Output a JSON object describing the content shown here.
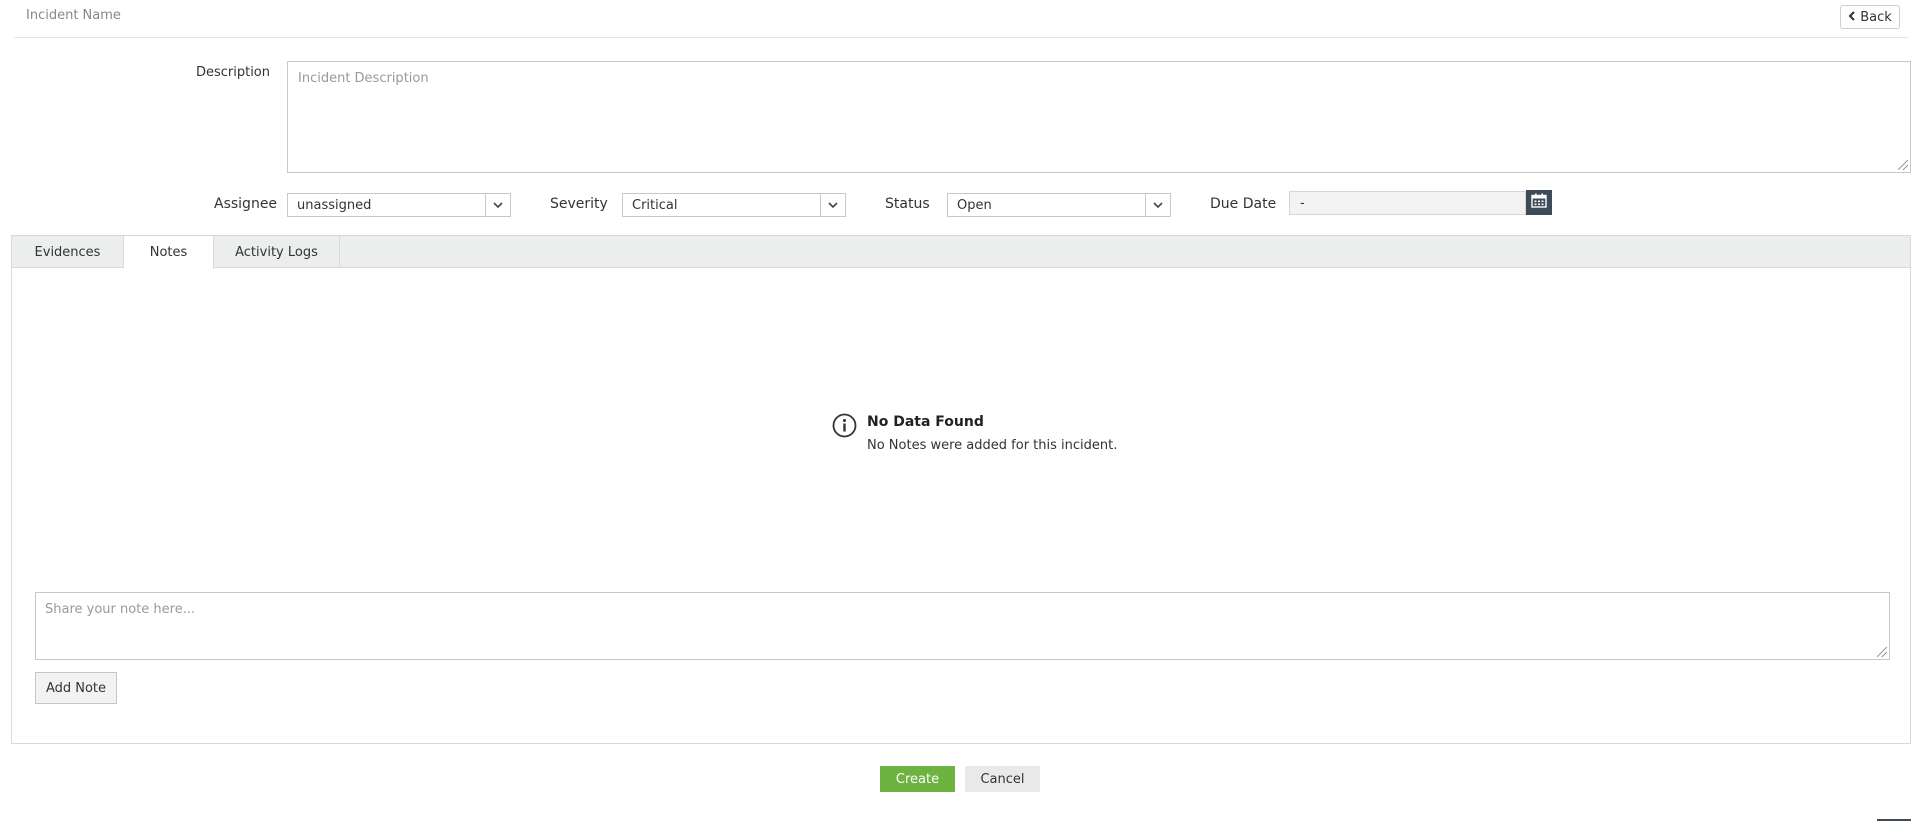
{
  "header": {
    "title": "Incident Name",
    "back_label": "Back"
  },
  "description": {
    "label": "Description",
    "placeholder": "Incident Description"
  },
  "fields": {
    "assignee": {
      "label": "Assignee",
      "value": "unassigned"
    },
    "severity": {
      "label": "Severity",
      "value": "Critical"
    },
    "status": {
      "label": "Status",
      "value": "Open"
    },
    "due_date": {
      "label": "Due Date",
      "value": "-"
    }
  },
  "tabs": [
    {
      "label": "Evidences",
      "active": false
    },
    {
      "label": "Notes",
      "active": true
    },
    {
      "label": "Activity Logs",
      "active": false
    }
  ],
  "notes": {
    "empty_title": "No Data Found",
    "empty_message": "No Notes were added for this incident.",
    "note_placeholder": "Share your note here...",
    "add_note_label": "Add Note"
  },
  "footer": {
    "create_label": "Create",
    "cancel_label": "Cancel"
  },
  "colors": {
    "primary_button": "#6db33f",
    "calendar_button": "#3e4a57",
    "tab_bar": "#eceeee"
  },
  "icons": {
    "back": "chevron-left-icon",
    "dropdown": "chevron-down-icon",
    "calendar": "calendar-icon",
    "info": "info-icon"
  }
}
